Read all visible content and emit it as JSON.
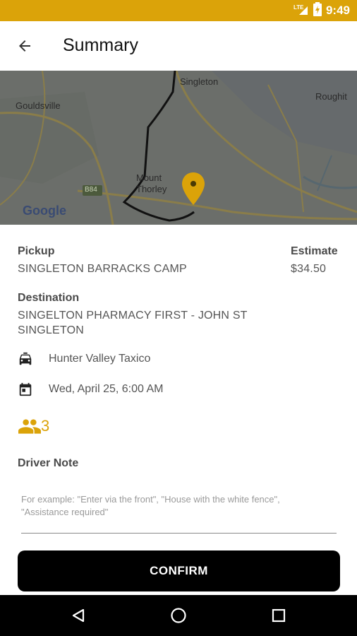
{
  "status_bar": {
    "time": "9:49",
    "network": "LTE"
  },
  "header": {
    "title": "Summary",
    "back_icon": "arrow-back-icon"
  },
  "map": {
    "places": [
      "Singleton",
      "Roughit",
      "Gouldsville",
      "Mount Thorley",
      "B84"
    ],
    "attribution": "Google",
    "pin_color": "#dba309"
  },
  "trip": {
    "pickup_label": "Pickup",
    "pickup_value": "SINGLETON BARRACKS CAMP",
    "estimate_label": "Estimate",
    "estimate_value": "$34.50",
    "destination_label": "Destination",
    "destination_line1": "SINGELTON PHARMACY FIRST - JOHN ST",
    "destination_line2": "SINGLETON",
    "company": "Hunter Valley Taxico",
    "datetime": "Wed, April 25, 6:00 AM",
    "passengers": "3"
  },
  "note": {
    "label": "Driver Note",
    "placeholder_line1": "For example: \"Enter via the front\", \"House with the white fence\",",
    "placeholder_line2": "\"Assistance required\""
  },
  "actions": {
    "confirm_label": "CONFIRM"
  },
  "colors": {
    "accent": "#dba309",
    "button_bg": "#000000",
    "nav_bg": "#000000"
  }
}
